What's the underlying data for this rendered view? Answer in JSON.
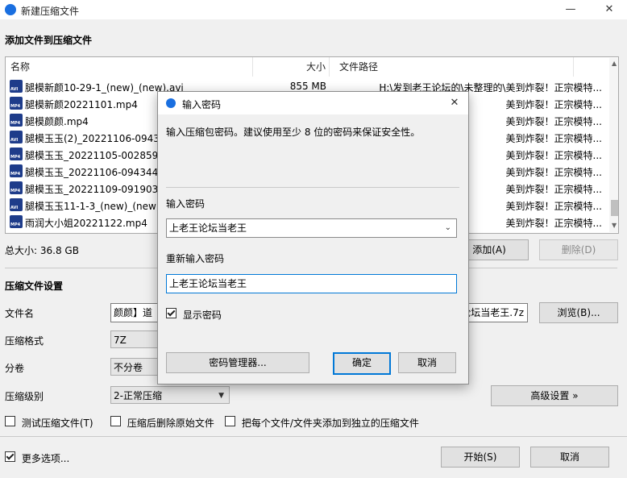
{
  "window": {
    "title": "新建压缩文件",
    "minimize": "—",
    "close": "✕"
  },
  "section_add": "添加文件到压缩文件",
  "file_list": {
    "columns": [
      "名称",
      "大小",
      "文件路径"
    ],
    "rows": [
      {
        "name": "腿模新颜10-29-1_(new)_(new).avi",
        "size": "855 MB",
        "path": "H:\\发到老王论坛的\\未整理的\\美到炸裂！正宗模特...",
        "type": "AVI"
      },
      {
        "name": "腿模新颜20221101.mp4",
        "size": "",
        "path": "美到炸裂！正宗模特...",
        "type": "MP4"
      },
      {
        "name": "腿模颜颜.mp4",
        "size": "",
        "path": "美到炸裂！正宗模特...",
        "type": "MP4"
      },
      {
        "name": "腿模玉玉(2)_20221106-094343",
        "size": "",
        "path": "美到炸裂！正宗模特...",
        "type": "AVI"
      },
      {
        "name": "腿模玉玉_20221105-002859-3",
        "size": "",
        "path": "美到炸裂！正宗模特...",
        "type": "MP4"
      },
      {
        "name": "腿模玉玉_20221106-094344-3",
        "size": "",
        "path": "美到炸裂！正宗模特...",
        "type": "MP4"
      },
      {
        "name": "腿模玉玉_20221109-091903-0",
        "size": "",
        "path": "美到炸裂！正宗模特...",
        "type": "MP4"
      },
      {
        "name": "腿模玉玉11-1-3_(new)_(new).a",
        "size": "",
        "path": "美到炸裂！正宗模特...",
        "type": "AVI"
      },
      {
        "name": "雨润大小姐20221122.mp4",
        "size": "",
        "path": "美到炸裂！正宗模特...",
        "type": "MP4"
      }
    ]
  },
  "total_size": "总大小: 36.8 GB",
  "add_button": "添加(A)",
  "delete_button": "删除(D)",
  "settings_title": "压缩文件设置",
  "filename_label": "文件名",
  "filename_value_left": "颜颜】道",
  "filename_value_right": "论坛当老王.7z",
  "browse_button": "浏览(B)...",
  "format_label": "压缩格式",
  "format_value": "7Z",
  "split_label": "分卷",
  "split_value": "不分卷",
  "level_label": "压缩级别",
  "level_value": "2-正常压缩",
  "advanced_button": "高级设置 »",
  "test_check": "测试压缩文件(T)",
  "delete_after_check": "压缩后删除原始文件",
  "separate_check": "把每个文件/文件夹添加到独立的压缩文件",
  "more_options": "更多选项...",
  "start_button": "开始(S)",
  "cancel_button": "取消",
  "dialog": {
    "title": "输入密码",
    "close": "✕",
    "hint": "输入压缩包密码。建议使用至少 8 位的密码来保证安全性。",
    "password_label": "输入密码",
    "password_value": "上老王论坛当老王",
    "confirm_label": "重新输入密码",
    "confirm_value": "上老王论坛当老王",
    "show_password": "显示密码",
    "manager_button": "密码管理器...",
    "ok_button": "确定",
    "cancel_button": "取消"
  },
  "colors": {
    "accent": "#1a6fe0",
    "focus_border": "#0078d7"
  }
}
